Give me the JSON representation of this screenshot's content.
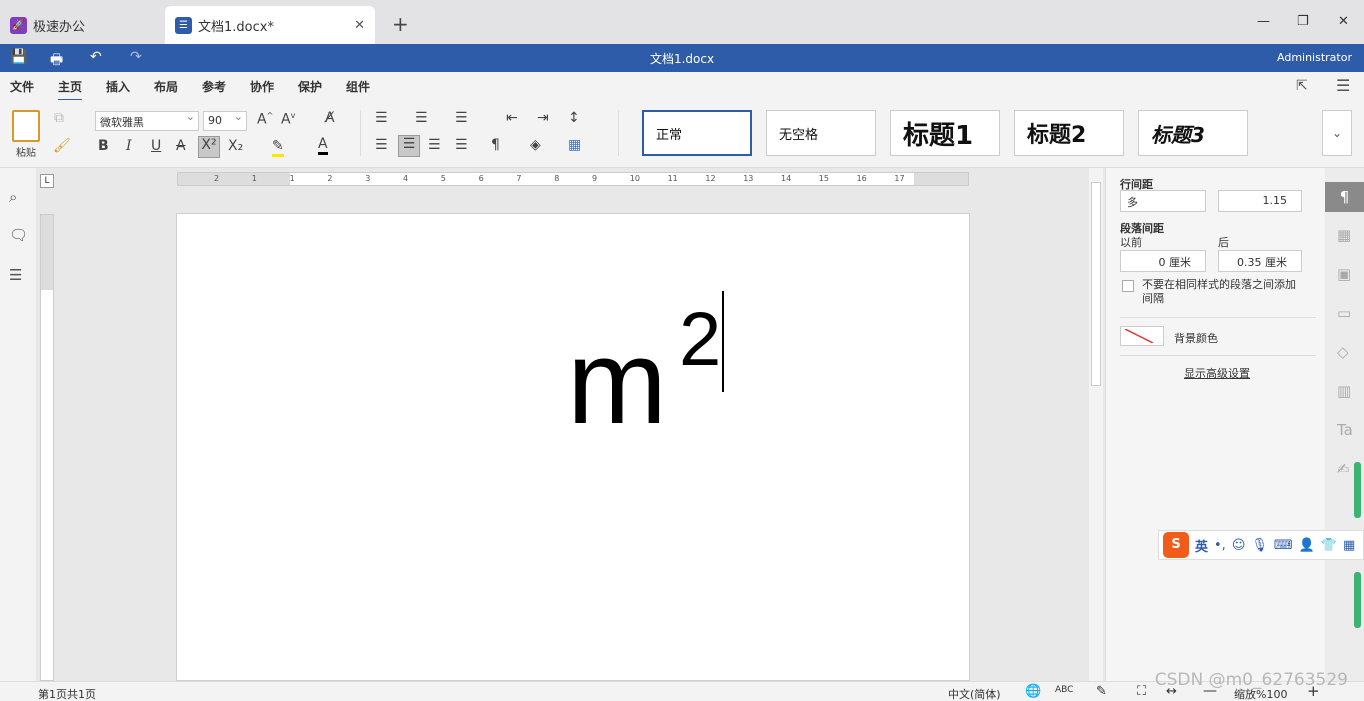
{
  "tabs": {
    "app": "极速办公",
    "doc": "文档1.docx*"
  },
  "titlebar": {
    "title": "文档1.docx",
    "user": "Administrator"
  },
  "menu": [
    "文件",
    "主页",
    "插入",
    "布局",
    "参考",
    "协作",
    "保护",
    "组件"
  ],
  "ribbon": {
    "paste_label": "粘贴",
    "font_name": "微软雅黑",
    "font_size": "90",
    "bold": "B",
    "italic": "I",
    "underline": "U",
    "styles": [
      "正常",
      "无空格",
      "标题1",
      "标题2",
      "标题3"
    ]
  },
  "ruler": {
    "h_ticks": [
      "2",
      "1",
      "1",
      "2",
      "3",
      "4",
      "5",
      "6",
      "7",
      "8",
      "9",
      "10",
      "11",
      "12",
      "13",
      "14",
      "15",
      "16",
      "17"
    ]
  },
  "document": {
    "base": "m",
    "superscript": "2"
  },
  "panel": {
    "line_spacing_label": "行间距",
    "line_spacing_mode": "多",
    "line_spacing_value": "1.15",
    "para_spacing_label": "段落间距",
    "before_label": "以前",
    "after_label": "后",
    "before_value": "0 厘米",
    "after_value": "0.35 厘米",
    "checkbox_label": "不要在相同样式的段落之间添加间隔",
    "bg_color_label": "背景颜色",
    "advanced_link": "显示高级设置"
  },
  "ime": {
    "logo": "S",
    "lang": "英"
  },
  "status": {
    "page": "第1页共1页",
    "lang": "中文(简体)",
    "zoom": "缩放%100"
  },
  "watermark": "CSDN @m0_62763529"
}
